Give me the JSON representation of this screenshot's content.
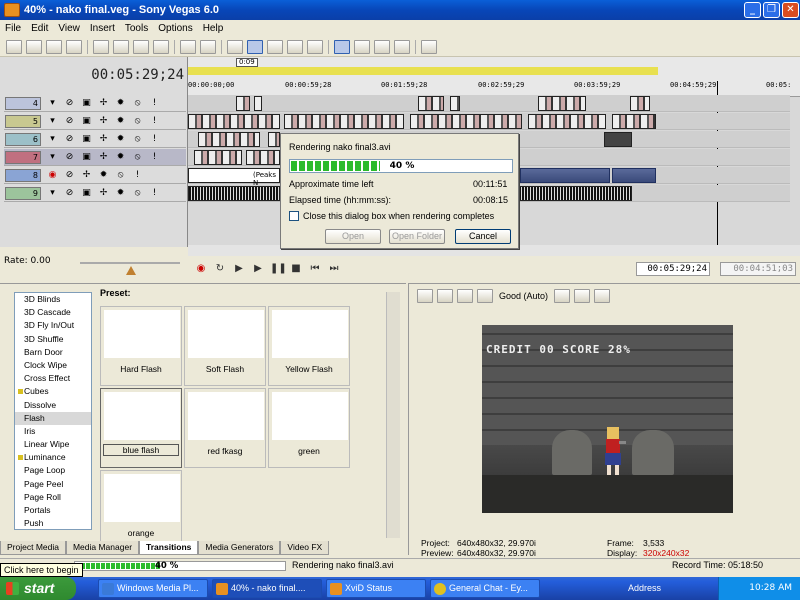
{
  "window": {
    "title": "40% - nako final.veg - Sony Vegas 6.0"
  },
  "menu": [
    "File",
    "Edit",
    "View",
    "Insert",
    "Tools",
    "Options",
    "Help"
  ],
  "timeline": {
    "cursor_time": "00:05:29;24",
    "marker_label": "0:09",
    "ruler_ticks": [
      "00:00:00;00",
      "00:00:59;28",
      "00:01:59;28",
      "00:02:59;29",
      "00:03:59;29",
      "00:04:59;29",
      "00:05:"
    ],
    "tracks": [
      "4",
      "5",
      "6",
      "7",
      "8",
      "9"
    ],
    "peaks_label": "(Peaks N"
  },
  "render_dialog": {
    "title": "Rendering nako final3.avi",
    "progress_text": "40 %",
    "progress": 0.4,
    "approx_label": "Approximate time left",
    "approx_value": "00:11:51",
    "elapsed_label": "Elapsed time (hh:mm:ss):",
    "elapsed_value": "00:08:15",
    "checkbox_label": "Close this dialog box when rendering completes",
    "btn_open": "Open",
    "btn_open_folder": "Open Folder",
    "btn_cancel": "Cancel"
  },
  "transport": {
    "rate": "Rate: 0.00",
    "time": "00:05:29;24",
    "length": "00:04:51;03"
  },
  "transitions": {
    "list": [
      "3D Blinds",
      "3D Cascade",
      "3D Fly In/Out",
      "3D Shuffle",
      "Barn Door",
      "Clock Wipe",
      "Cross Effect",
      "Cubes",
      "Dissolve",
      "Flash",
      "Iris",
      "Linear Wipe",
      "Luminance",
      "Page Loop",
      "Page Peel",
      "Page Roll",
      "Portals",
      "Push"
    ],
    "marked": [
      "Cubes",
      "Luminance"
    ],
    "selected": "Flash",
    "preset_label": "Preset:",
    "presets": [
      "Hard Flash",
      "Soft Flash",
      "Yellow Flash",
      "blue flash",
      "red fkasg",
      "green",
      "orange"
    ],
    "selected_preset": "blue flash"
  },
  "tabs": [
    "Project Media",
    "Media Manager",
    "Transitions",
    "Media Generators",
    "Video FX"
  ],
  "active_tab": "Transitions",
  "preview": {
    "quality": "Good (Auto)",
    "hud_text": "CREDIT 00  SCORE 28%",
    "project_label": "Project:",
    "project_value": "640x480x32, 29.970i",
    "preview_label": "Preview:",
    "preview_value": "640x480x32, 29.970i",
    "frame_label": "Frame:",
    "frame_value": "3,533",
    "display_label": "Display:",
    "display_value": "320x240x32",
    "display_color": "#cc0000"
  },
  "status": {
    "progress_text": "40 %",
    "progress": 0.4,
    "rendering_text": "Rendering nako final3.avi",
    "record_time": "Record Time: 05:18:50",
    "tooltip": "Click here to begin"
  },
  "taskbar": {
    "start": "start",
    "tasks": [
      "Windows Media Pl...",
      "40% - nako final....",
      "XviD Status",
      "General Chat - Ey..."
    ],
    "address": "Address",
    "clock": "10:28 AM"
  }
}
